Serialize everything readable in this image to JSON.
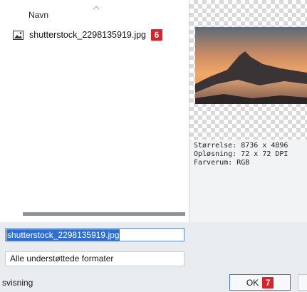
{
  "file_list": {
    "column_header": "Navn",
    "items": [
      {
        "name": "shutterstock_2298135919.jpg",
        "icon": "image-file-icon",
        "badge": "6"
      }
    ]
  },
  "preview": {
    "info_lines": [
      "Størrelse: 8736 x 4896",
      "Opløsning: 72 x 72 DPI",
      "Farverum: RGB"
    ]
  },
  "filename_field": {
    "value": "shutterstock_2298135919.jpg"
  },
  "format_select": {
    "selected": "Alle understøttede formater"
  },
  "preview_label": "svisning",
  "ok_button": {
    "label": "OK",
    "badge": "7"
  },
  "colors": {
    "accent": "#2f6fd1",
    "badge": "#d7232d"
  }
}
